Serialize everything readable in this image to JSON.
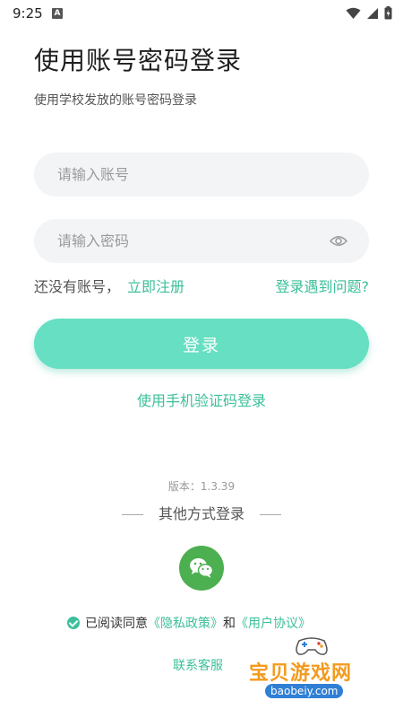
{
  "status_bar": {
    "time": "9:25",
    "notification_badge": "A"
  },
  "header": {
    "title": "使用账号密码登录",
    "subtitle": "使用学校发放的账号密码登录"
  },
  "form": {
    "account_placeholder": "请输入账号",
    "password_placeholder": "请输入密码",
    "no_account_text": "还没有账号，",
    "register_link": "立即注册",
    "problem_link": "登录遇到问题?",
    "login_button": "登录",
    "sms_login_link": "使用手机验证码登录"
  },
  "footer": {
    "version": "版本：1.3.39",
    "other_login_label": "其他方式登录",
    "agreement_prefix": "已阅读同意",
    "privacy_link": "《隐私政策》",
    "and_text": "和",
    "user_agreement_link": "《用户协议》",
    "contact_service": "联系客服"
  },
  "watermark": {
    "title": "宝贝游戏网",
    "url": "baobeiy.com"
  },
  "colors": {
    "accent": "#3cbf9a",
    "button": "#66dfc2",
    "wechat": "#4caf50",
    "field_bg": "#f3f4f6"
  },
  "icons": [
    "wifi-icon",
    "signal-icon",
    "battery-icon",
    "eye-icon",
    "wechat-icon",
    "check-icon"
  ]
}
